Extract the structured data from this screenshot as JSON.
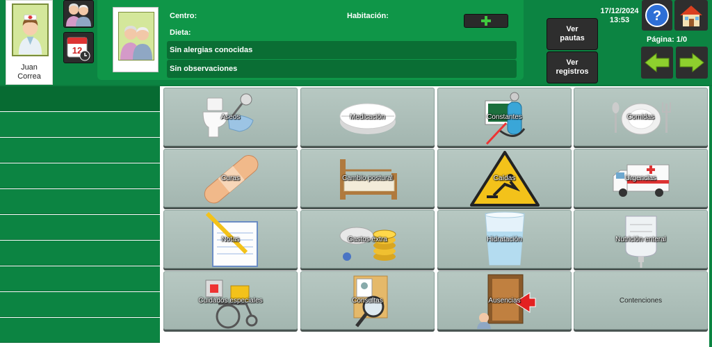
{
  "user": {
    "first_name": "Juan",
    "last_name": "Correa"
  },
  "resident": {
    "centro_label": "Centro:",
    "habitacion_label": "Habitación:",
    "dieta_label": "Dieta:",
    "alergias": "Sin alergias conocidas",
    "observaciones": "Sin observaciones"
  },
  "buttons": {
    "ver_pautas": [
      "Ver",
      "pautas"
    ],
    "ver_registros": [
      "Ver",
      "registros"
    ]
  },
  "datetime": {
    "date": "17/12/2024",
    "time": "13:53"
  },
  "pagination": {
    "label": "Página: 1/0"
  },
  "tiles": [
    {
      "label": "Aseos",
      "icon": "toilet-icon"
    },
    {
      "label": "Medicación",
      "icon": "pill-icon"
    },
    {
      "label": "Constantes",
      "icon": "blood-pressure-icon"
    },
    {
      "label": "Comidas",
      "icon": "plate-cutlery-icon"
    },
    {
      "label": "Curas",
      "icon": "bandage-icon"
    },
    {
      "label": "Cambio postural",
      "icon": "bed-icon"
    },
    {
      "label": "Caídas",
      "icon": "fall-warning-icon"
    },
    {
      "label": "Urgencias",
      "icon": "ambulance-icon"
    },
    {
      "label": "Notas",
      "icon": "notepad-pencil-icon"
    },
    {
      "label": "Gastos extra",
      "icon": "coins-icon"
    },
    {
      "label": "Hidratación",
      "icon": "water-glass-icon"
    },
    {
      "label": "Nutrición enteral",
      "icon": "iv-bag-icon"
    },
    {
      "label": "Cuidados especiales",
      "icon": "wheelchair-icon"
    },
    {
      "label": "Consultas",
      "icon": "folder-magnifier-icon"
    },
    {
      "label": "Ausencias",
      "icon": "door-exit-icon"
    },
    {
      "label": "Contenciones",
      "icon": ""
    }
  ],
  "colors": {
    "header_green": "#0c8442",
    "panel_green": "#0f9648",
    "tile": "#aebfb9"
  }
}
